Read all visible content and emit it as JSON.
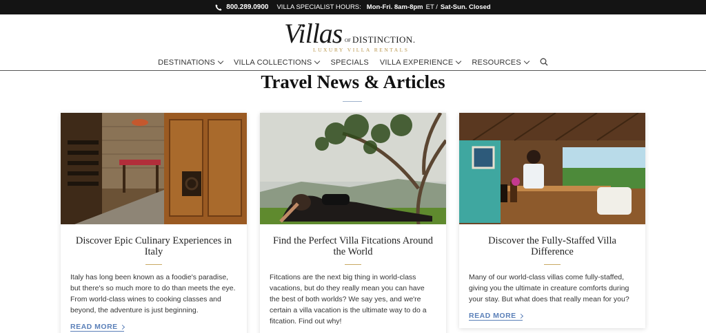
{
  "topbar": {
    "phone": "800.289.0900",
    "hours_label": "Villa Specialist Hours:",
    "hours_weekday": "Mon-Fri. 8am-8pm",
    "hours_tz": "ET /",
    "hours_weekend": "Sat-Sun. Closed"
  },
  "logo": {
    "script": "Villas",
    "of": "OF",
    "distinction": "DISTINCTION.",
    "tagline": "Luxury Villa Rentals"
  },
  "nav": {
    "destinations": "Destinations",
    "collections": "Villa Collections",
    "specials": "Specials",
    "experience": "Villa Experience",
    "resources": "Resources"
  },
  "page": {
    "title": "Travel News & Articles"
  },
  "articles": [
    {
      "title": "Discover Epic Culinary Experiences in Italy",
      "excerpt": "Italy has long been known as a foodie's paradise, but there's so much more to do than meets the eye. From world-class wines to cooking classes and beyond, the adventure is just beginning.",
      "cta": "READ MORE"
    },
    {
      "title": "Find the Perfect Villa Fitcations Around the World",
      "excerpt": "Fitcations are the next big thing in world-class vacations, but do they really mean you can have the best of both worlds? We say yes, and we're certain a villa vacation is the ultimate way to do a fitcation. Find out why!",
      "cta": ""
    },
    {
      "title": "Discover the Fully-Staffed Villa Difference",
      "excerpt": "Many of our world-class villas come fully-staffed, giving you the ultimate in creature comforts during your stay. But what does that really mean for you?",
      "cta": "READ MORE"
    }
  ],
  "colors": {
    "topbar": "#141414",
    "accent_gold": "#c9a862",
    "link_blue": "#5a7fb8"
  },
  "icons": {
    "phone": "phone-icon",
    "search": "search-icon",
    "dropdown": "chevron-down-icon",
    "read_more": "chevron-right-icon"
  }
}
